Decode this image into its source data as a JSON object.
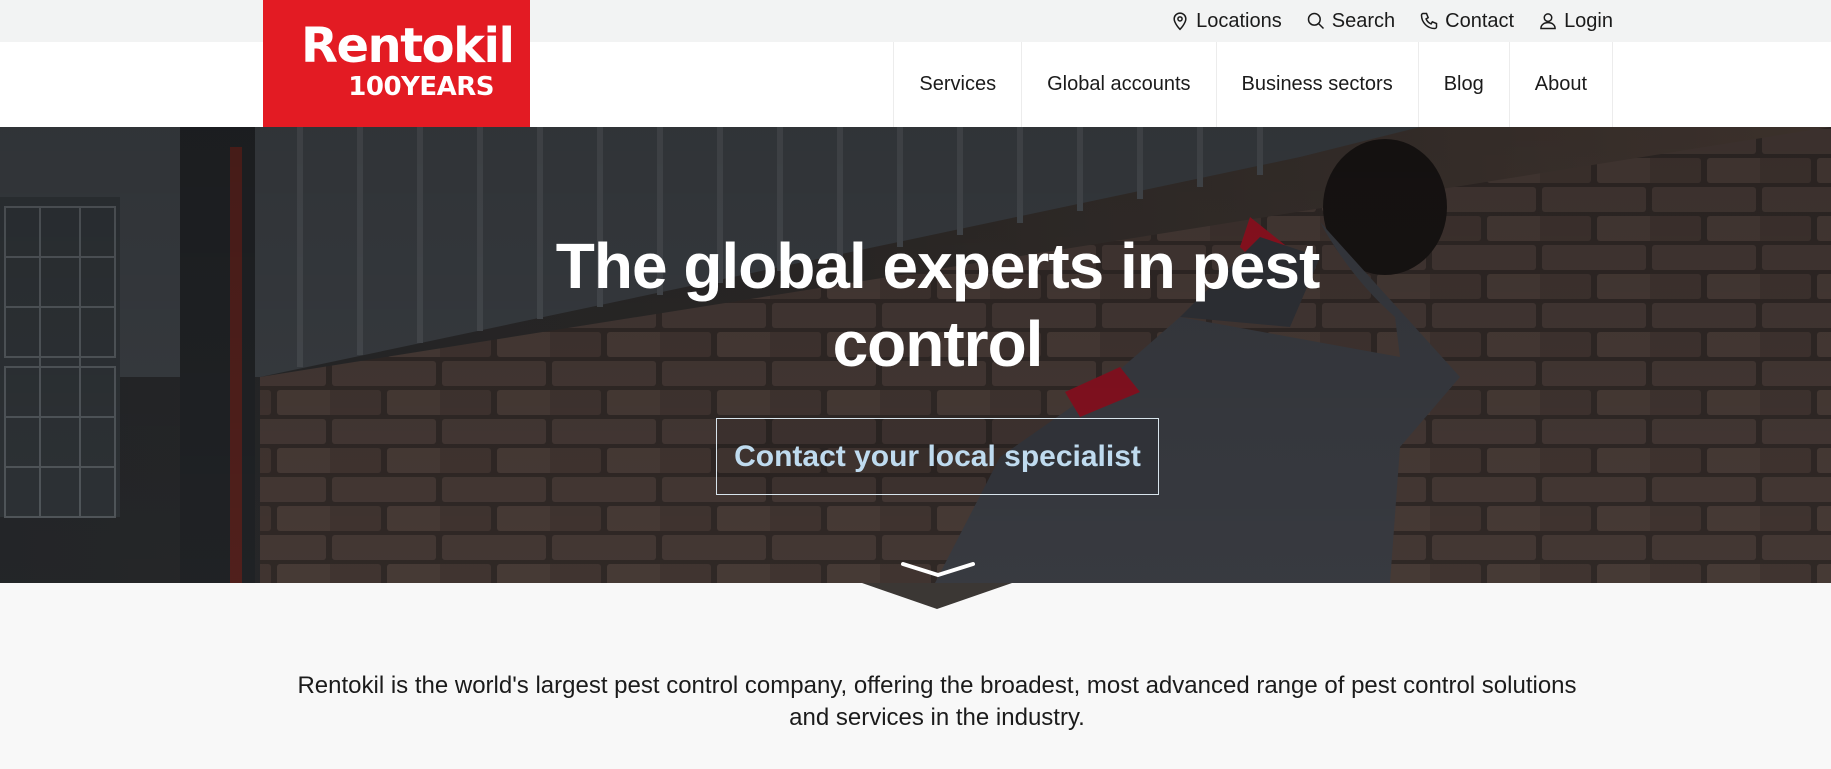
{
  "logo": {
    "name": "Rentokil",
    "tagline": "100YEARS"
  },
  "utility": {
    "locations": {
      "label": "Locations",
      "icon": "map-pin-icon"
    },
    "search": {
      "label": "Search",
      "icon": "search-icon"
    },
    "contact": {
      "label": "Contact",
      "icon": "phone-icon"
    },
    "login": {
      "label": "Login",
      "icon": "user-icon"
    }
  },
  "nav": {
    "items": [
      {
        "label": "Services"
      },
      {
        "label": "Global accounts"
      },
      {
        "label": "Business sectors"
      },
      {
        "label": "Blog"
      },
      {
        "label": "About"
      }
    ]
  },
  "hero": {
    "title_line1": "The global experts in pest",
    "title_line2": "control",
    "cta": "Contact your local specialist",
    "scroll_icon": "chevron-down-icon"
  },
  "intro": {
    "line1": "Rentokil is the world's largest pest control company, offering the broadest, most advanced range of pest control solutions",
    "line2": "and services in the industry."
  },
  "colors": {
    "brand_red": "#e31b23",
    "cta_text": "#bfdbef",
    "utility_bg": "#f2f3f3",
    "page_bg": "#f8f8f8"
  }
}
